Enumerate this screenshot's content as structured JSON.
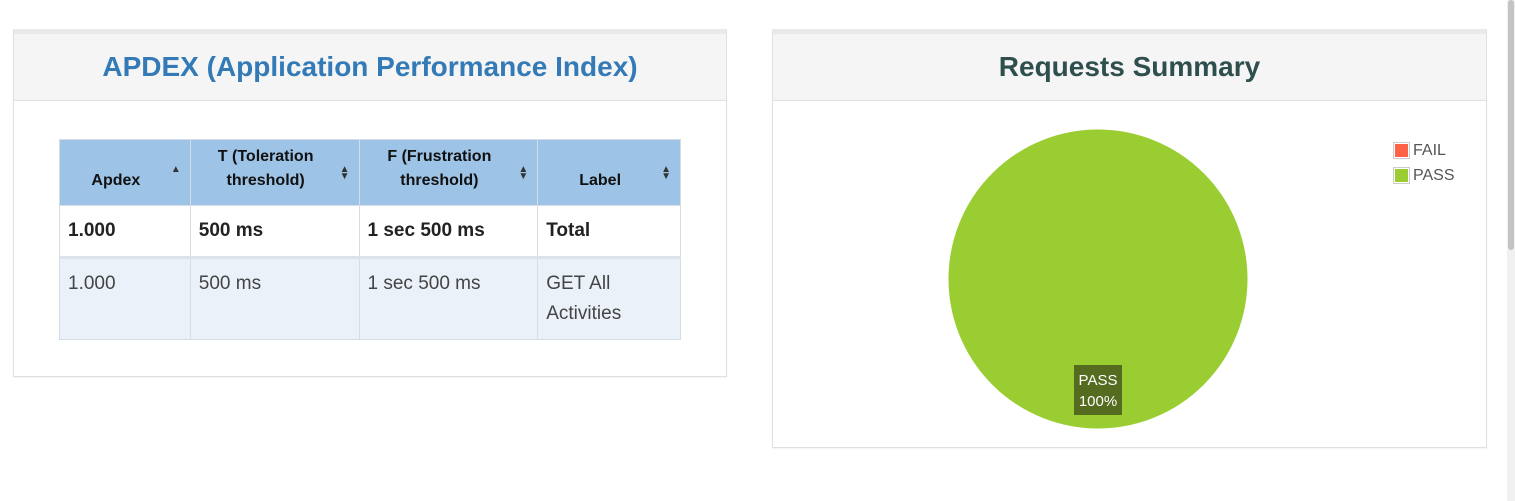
{
  "apdex": {
    "title": "APDEX (Application Performance Index)",
    "columns": [
      {
        "line1": "Apdex",
        "line2": ""
      },
      {
        "line1": "T (Toleration",
        "line2": "threshold)"
      },
      {
        "line1": "F (Frustration",
        "line2": "threshold)"
      },
      {
        "line1": "Label",
        "line2": ""
      }
    ],
    "rows": [
      {
        "apdex": "1.000",
        "t": "500 ms",
        "f": "1 sec 500 ms",
        "label": "Total"
      },
      {
        "apdex": "1.000",
        "t": "500 ms",
        "f": "1 sec 500 ms",
        "label": "GET All Activities"
      }
    ]
  },
  "summary": {
    "title": "Requests Summary",
    "legend": [
      {
        "label": "FAIL",
        "color": "#ff6347"
      },
      {
        "label": "PASS",
        "color": "#9acd32"
      }
    ]
  },
  "chart_data": {
    "type": "pie",
    "categories": [
      "FAIL",
      "PASS"
    ],
    "values": [
      0,
      100
    ],
    "colors": [
      "#ff6347",
      "#9acd32"
    ],
    "slice_label": {
      "name": "PASS",
      "value": "100%"
    },
    "legend_position": "top-right"
  }
}
